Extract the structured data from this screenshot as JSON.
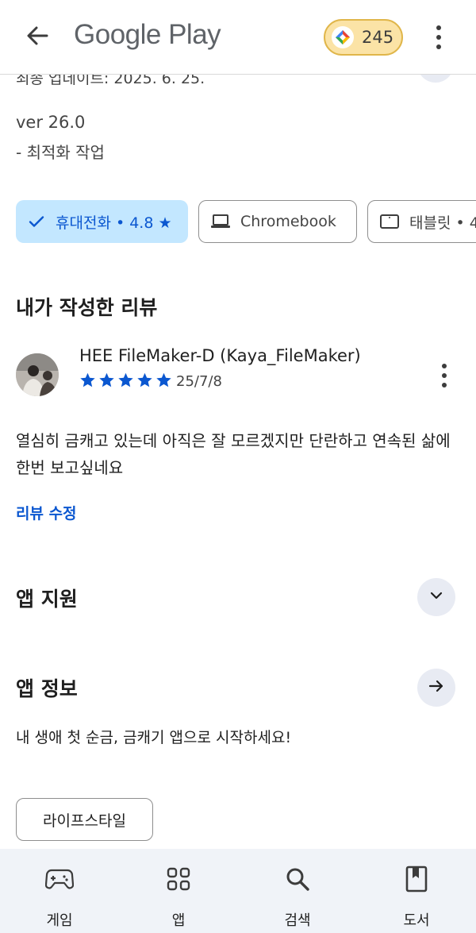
{
  "appbar": {
    "brand": "Google Play",
    "points": "245"
  },
  "details": {
    "updated": "최종 업데이트: 2025. 6. 25.",
    "version": "ver 26.0",
    "change": "- 최적화 작업"
  },
  "devices": [
    {
      "label": "휴대전화 • 4.8 ★",
      "icon": "check-icon",
      "selected": true
    },
    {
      "label": "Chromebook",
      "icon": "laptop-icon",
      "selected": false
    },
    {
      "label": "태블릿 • 4",
      "icon": "tablet-icon",
      "selected": false
    }
  ],
  "my_review": {
    "title": "내가 작성한 리뷰",
    "reviewer": "HEE FileMaker-D (Kaya_FileMaker)",
    "rating": 5,
    "date": "25/7/8",
    "text": "열심히 금캐고 있는데 아직은 잘 모르겠지만 단란하고 연속된 삶에 한번 보고싶네요",
    "edit_label": "리뷰 수정"
  },
  "app_support": {
    "title": "앱 지원"
  },
  "app_info": {
    "title": "앱 정보",
    "text": "내 생애 첫 순금, 금캐기 앱으로 시작하세요!",
    "tag": "라이프스타일"
  },
  "bottom_nav": [
    {
      "label": "게임",
      "icon": "gamepad-icon"
    },
    {
      "label": "앱",
      "icon": "apps-grid-icon"
    },
    {
      "label": "검색",
      "icon": "search-icon"
    },
    {
      "label": "도서",
      "icon": "book-icon"
    }
  ],
  "colors": {
    "accent": "#0b57d0",
    "chip_selected_bg": "#c3e7ff",
    "points_bg": "#fbe3a6",
    "nav_bg": "#f0f3f8"
  }
}
